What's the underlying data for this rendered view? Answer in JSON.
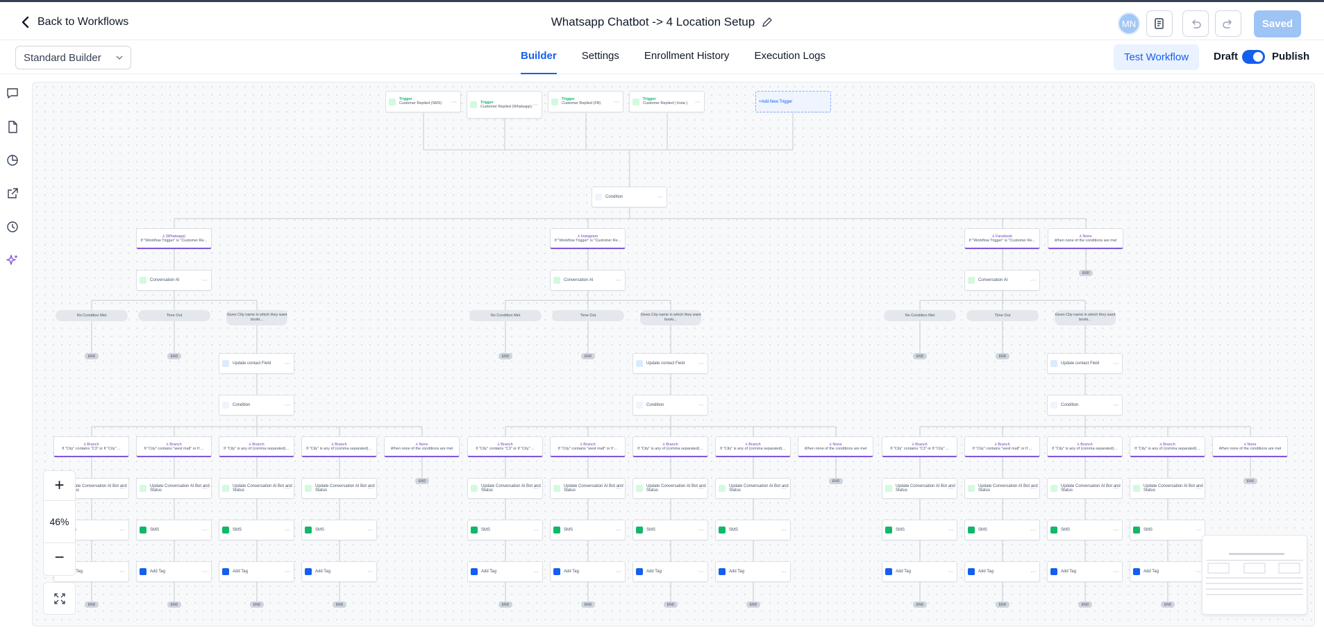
{
  "header": {
    "back_label": "Back to Workflows",
    "title": "Whatsapp Chatbot -> 4 Location Setup",
    "avatar_initials": "MN",
    "saved_label": "Saved"
  },
  "toolbar": {
    "builder_select": "Standard Builder",
    "tabs": [
      "Builder",
      "Settings",
      "Enrollment History",
      "Execution Logs"
    ],
    "active_tab": "Builder",
    "test_label": "Test Workflow",
    "draft_label": "Draft",
    "publish_label": "Publish"
  },
  "sidebar_icons": [
    "chat-icon",
    "document-icon",
    "pie-chart-icon",
    "external-link-icon",
    "history-icon",
    "sparkle-icon"
  ],
  "zoom": {
    "plus": "+",
    "value": "46%",
    "minus": "−"
  },
  "canvas": {
    "trigger_title": "Trigger",
    "triggers": [
      "Customer Replied (SMS)",
      "Customer Replied (Whatsapp)",
      "Customer Replied (FB)",
      "Customer Replied ( Insta )"
    ],
    "add_trigger": "Add New Trigger",
    "condition": "Condition",
    "top_branches": [
      {
        "title": "(Whatsapp)",
        "sub": "If \"Workflow Trigger\" is \"Customer Re..."
      },
      {
        "title": "Instagram",
        "sub": "If \"Workflow Trigger\" is \"Customer Re..."
      },
      {
        "title": "Facebook",
        "sub": "If \"Workflow Trigger\" is \"Customer Re..."
      }
    ],
    "none_branch": {
      "title": "None",
      "sub": "When none of the conditions are met"
    },
    "end": "END",
    "conversation_ai": "Conversation AI",
    "outcomes": [
      "No Condition Met",
      "Time Out",
      "Gives City name in which they want booki..."
    ],
    "update_contact": "Update contact Field",
    "city_branch_title": "Branch",
    "city_branches": [
      "If \"City\" contains \"C3\" or If \"City\" ...",
      "If \"City\" contains \"west mall\" or If ...",
      "If \"City\" is any of (comma separated)…",
      "If \"City\" is any of (comma separated)…"
    ],
    "update_ai": "Update Conversation AI Bot and Status",
    "sms": "SMS",
    "add_tag": "Add Tag"
  }
}
